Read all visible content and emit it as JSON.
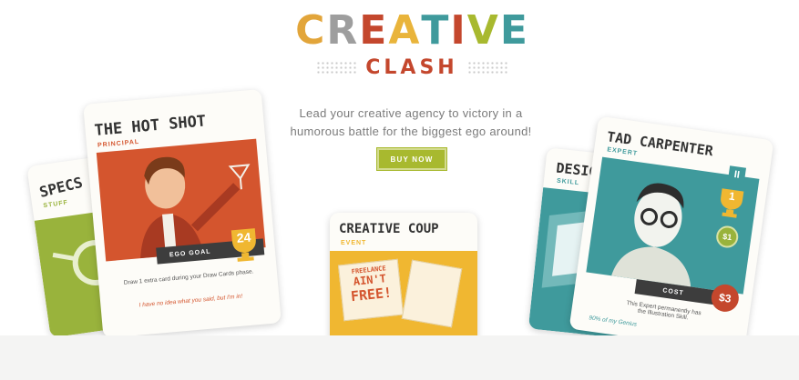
{
  "logo": {
    "top_letters": [
      "C",
      "R",
      "E",
      "A",
      "T",
      "I",
      "V",
      "E"
    ],
    "bottom_text": "CLASH"
  },
  "tagline": {
    "line1": "Lead your creative agency to victory in a",
    "line2": "humorous battle for the biggest ego around!"
  },
  "cta": {
    "label": "BUY NOW"
  },
  "cards": {
    "specs": {
      "title": "SPECS",
      "subtitle": "STUFF"
    },
    "hot_shot": {
      "title": "THE HOT SHOT",
      "subtitle": "PRINCIPAL",
      "ego_label": "EGO GOAL",
      "ego_value": "24",
      "rule_text": "Draw 1 extra card during your Draw Cards phase.",
      "quote": "I have no idea what you said, but I'm in!"
    },
    "creative_coup": {
      "title": "CREATIVE COUP",
      "subtitle": "EVENT",
      "sign_line1": "FREELANCE",
      "sign_line2": "AIN'T",
      "sign_line3": "FREE!"
    },
    "design": {
      "title": "DESIGN",
      "subtitle": "SKILL"
    },
    "tad": {
      "title": "TAD CARPENTER",
      "subtitle": "EXPERT",
      "badge": "II",
      "trophy_value": "1",
      "coin_value": "$1",
      "cost_label": "COST",
      "cost_value": "$3",
      "rule_line1": "This Expert permanently has",
      "rule_line2": "the Illustration Skill.",
      "flavor": "90% of my Genius"
    }
  },
  "colors": {
    "brand_red": "#c4472d",
    "button_green": "#a8b92f",
    "card_orange": "#d4552e",
    "card_teal": "#3f9a9c",
    "card_yellow": "#f0b731",
    "card_green": "#99b33c"
  }
}
